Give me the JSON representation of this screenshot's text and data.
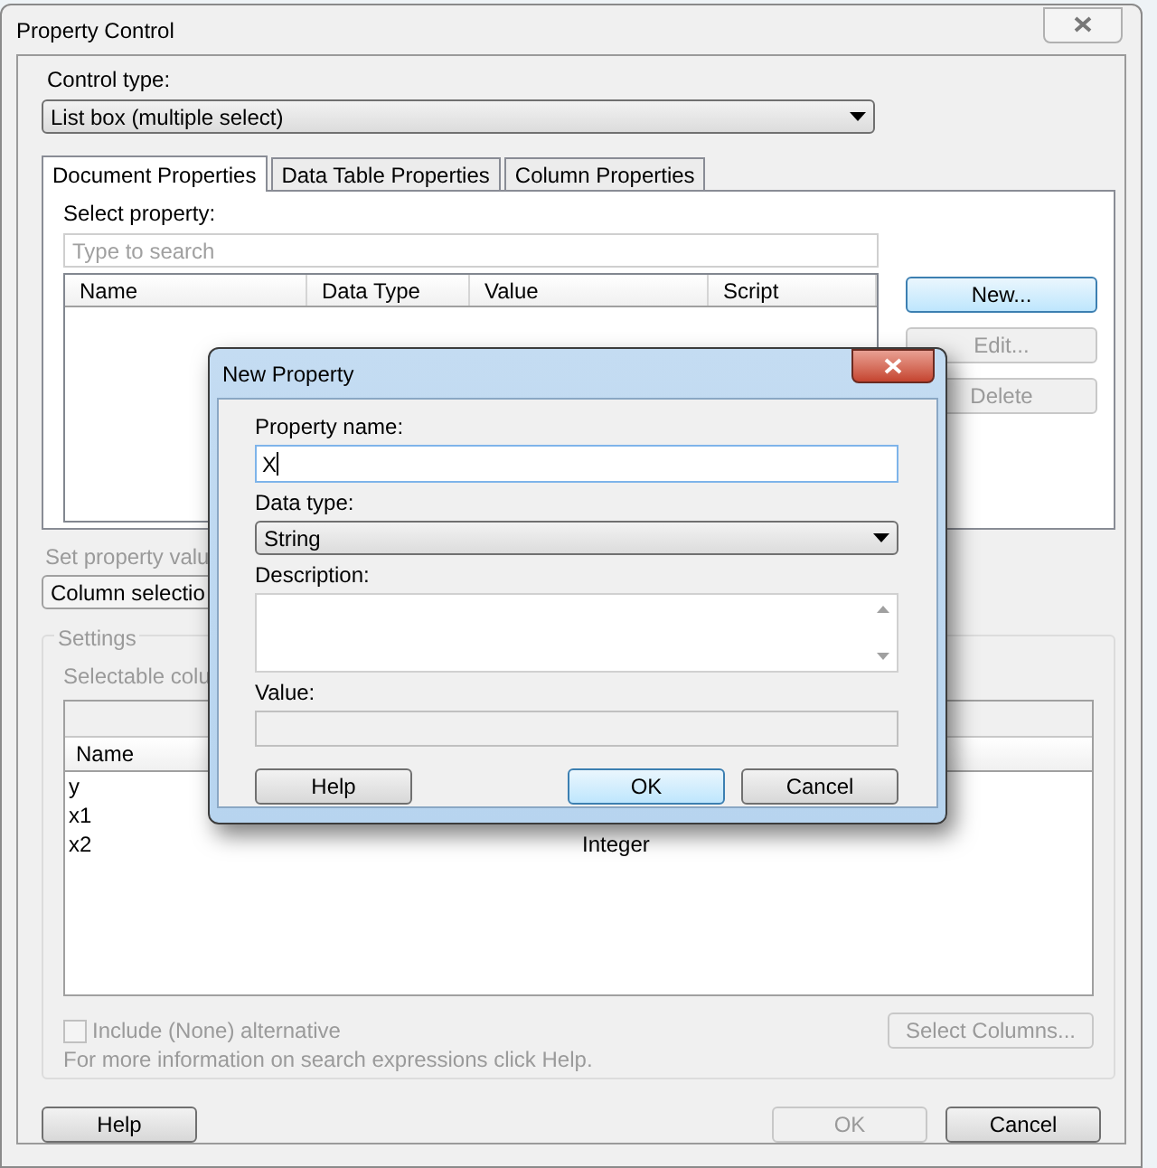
{
  "window": {
    "title": "Property Control"
  },
  "control_type": {
    "label": "Control type:",
    "value": "List box (multiple select)"
  },
  "tabs": [
    {
      "label": "Document Properties",
      "selected": true
    },
    {
      "label": "Data Table Properties",
      "selected": false
    },
    {
      "label": "Column Properties",
      "selected": false
    }
  ],
  "select_property": {
    "label": "Select property:",
    "placeholder": "Type to search"
  },
  "property_table": {
    "columns": [
      "Name",
      "Data Type",
      "Value",
      "Script"
    ]
  },
  "side_buttons": [
    {
      "label": "New...",
      "default": true,
      "disabled": false
    },
    {
      "label": "Edit...",
      "default": false,
      "disabled": true
    },
    {
      "label": "Delete",
      "default": false,
      "disabled": true
    }
  ],
  "set_property_value": {
    "label": "Set property valu",
    "value": "Column selectio",
    "disabled": true
  },
  "settings": {
    "legend": "Settings",
    "label": "Selectable colu",
    "columns": [
      "Name"
    ],
    "rows": [
      {
        "name": "y"
      },
      {
        "name": "x1"
      },
      {
        "name": "x2",
        "column_2": "Integer"
      }
    ]
  },
  "include_none": {
    "label": "Include (None) alternative",
    "checked": false,
    "disabled": true
  },
  "select_columns_button": {
    "label": "Select Columns...",
    "disabled": true
  },
  "help_text": "For more information on search expressions click Help.",
  "footer_buttons": [
    {
      "label": "Help",
      "disabled": false
    },
    {
      "label": "OK",
      "disabled": true
    },
    {
      "label": "Cancel",
      "disabled": false
    }
  ],
  "dialog": {
    "title": "New Property",
    "property_name": {
      "label": "Property name:",
      "value": "X"
    },
    "data_type": {
      "label": "Data type:",
      "value": "String"
    },
    "description": {
      "label": "Description:"
    },
    "value": {
      "label": "Value:",
      "disabled": true
    },
    "buttons": [
      {
        "label": "Help",
        "default": false
      },
      {
        "label": "OK",
        "default": true
      },
      {
        "label": "Cancel",
        "default": false
      }
    ]
  }
}
